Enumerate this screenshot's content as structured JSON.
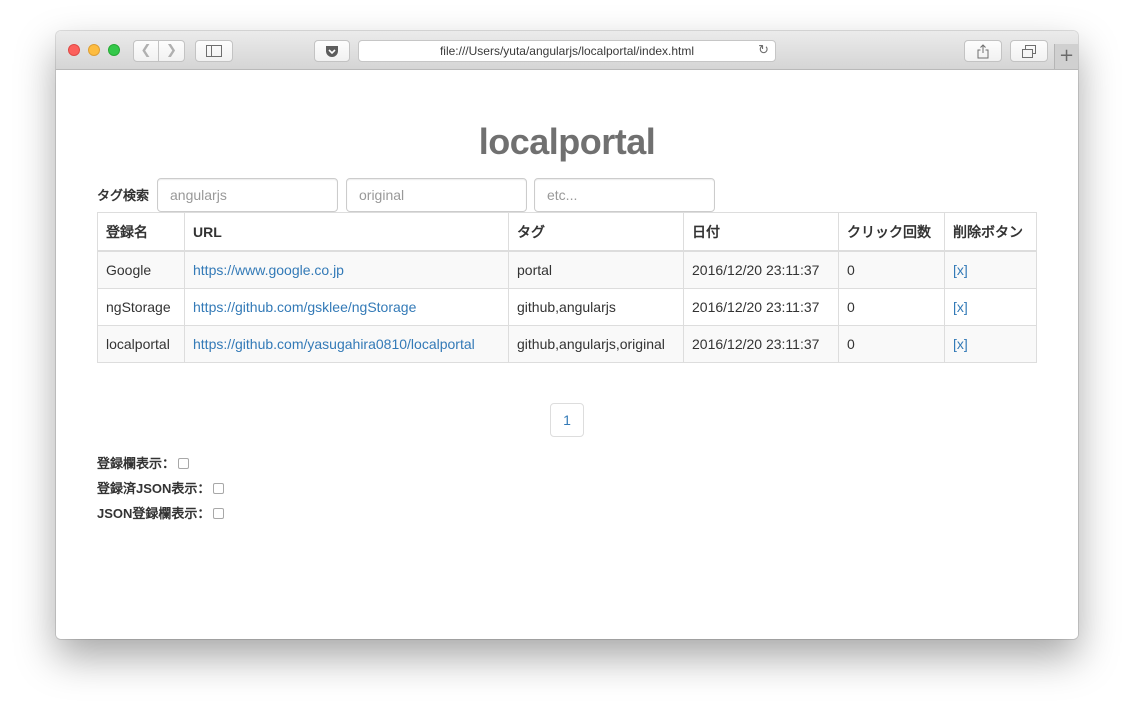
{
  "browser": {
    "address": "file:///Users/yuta/angularjs/localportal/index.html",
    "icons": {
      "back": "chevron-left-icon",
      "forward": "chevron-right-icon",
      "sidebar": "sidebar-icon",
      "pocket": "pocket-icon",
      "reload": "reload-icon",
      "share": "share-icon",
      "tabs": "tabs-icon",
      "new_tab": "plus-icon"
    }
  },
  "page": {
    "title": "localportal",
    "tag_search": {
      "label": "タグ検索",
      "placeholders": [
        "angularjs",
        "original",
        "etc..."
      ]
    },
    "table": {
      "headers": [
        "登録名",
        "URL",
        "タグ",
        "日付",
        "クリック回数",
        "削除ボタン"
      ],
      "rows": [
        {
          "name": "Google",
          "url": "https://www.google.co.jp",
          "tags": "portal",
          "date": "2016/12/20 23:11:37",
          "clicks": "0",
          "delete": "[x]"
        },
        {
          "name": "ngStorage",
          "url": "https://github.com/gsklee/ngStorage",
          "tags": "github,angularjs",
          "date": "2016/12/20 23:11:37",
          "clicks": "0",
          "delete": "[x]"
        },
        {
          "name": "localportal",
          "url": "https://github.com/yasugahira0810/localportal",
          "tags": "github,angularjs,original",
          "date": "2016/12/20 23:11:37",
          "clicks": "0",
          "delete": "[x]"
        }
      ]
    },
    "pagination": {
      "current": "1"
    },
    "options": [
      "登録欄表示：",
      "登録済JSON表示：",
      "JSON登録欄表示："
    ]
  },
  "colors": {
    "link": "#337ab7",
    "title": "#707070",
    "close": "#fc605c",
    "minimize": "#fdbc40",
    "maximize": "#34c84a"
  }
}
